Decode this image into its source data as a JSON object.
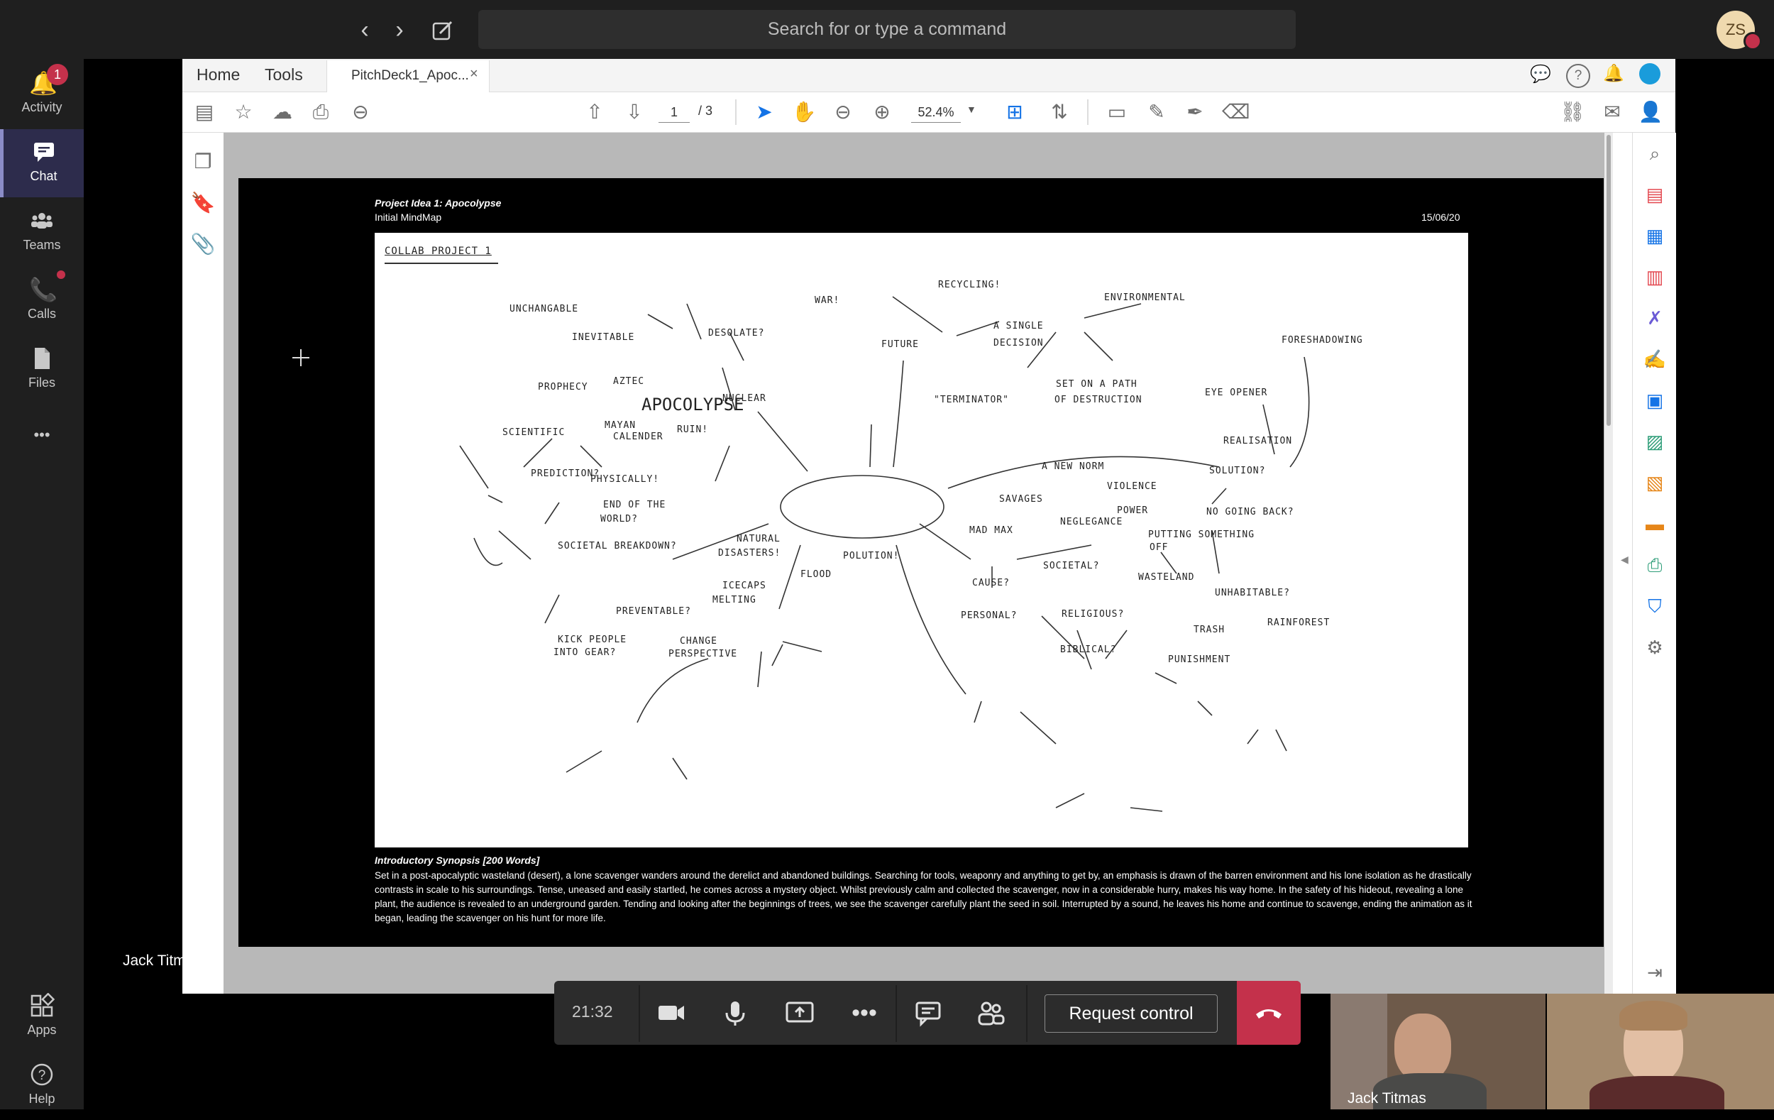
{
  "topbar": {
    "back_glyph": "‹",
    "forward_glyph": "›",
    "search_placeholder": "Search for or type a command",
    "avatar_initials": "ZS"
  },
  "rail": {
    "activity": {
      "label": "Activity",
      "badge": "1"
    },
    "chat": {
      "label": "Chat"
    },
    "teams": {
      "label": "Teams"
    },
    "calls": {
      "label": "Calls"
    },
    "files": {
      "label": "Files"
    },
    "more": {
      "label": "•••"
    },
    "apps": {
      "label": "Apps"
    },
    "help": {
      "label": "Help"
    }
  },
  "pdf": {
    "menu": {
      "home": "Home",
      "tools": "Tools"
    },
    "doc_tab": "PitchDeck1_Apoc...",
    "doc_tab_close": "×",
    "page_current": "1",
    "page_total": "/ 3",
    "zoom": "52.4%"
  },
  "slide": {
    "title": "Project Idea 1: Apocolypse",
    "subtitle": "Initial MindMap",
    "date": "15/06/20",
    "synopsis_title": "Introductory Synopsis [200 Words]",
    "synopsis_text": "Set in a post-apocalyptic wasteland (desert), a lone scavenger wanders around the derelict and abandoned buildings. Searching for tools, weaponry and anything to get by, an emphasis is drawn of the barren environment and his lone isolation as he drastically contrasts in scale to his surroundings. Tense, uneased and easily startled, he comes across a mystery object. Whilst previously calm and collected the scavenger, now in a considerable hurry, makes his way home. In the safety of his hideout, revealing a lone plant, the audience is revealed to an underground garden. Tending and looking after the beginnings of trees, we see the scavenger carefully plant the seed in soil. Interrupted by a sound, he leaves his home and continue to scavenge, ending the animation as it began, leading the scavenger on his hunt for more life."
  },
  "mindmap": {
    "header": "COLLAB PROJECT 1",
    "center": "APOCOLYPSE",
    "nodes": [
      "UNCHANGABLE",
      "INEVITABLE",
      "DESOLATE?",
      "WAR!",
      "RECYCLING!",
      "ENVIRONMENTAL",
      "A SINGLE",
      "DECISION",
      "FUTURE",
      "FORESHADOWING",
      "PROPHECY",
      "AZTEC",
      "NUCLEAR",
      "\"TERMINATOR\"",
      "SET ON A PATH",
      "OF DESTRUCTION",
      "EYE OPENER",
      "SCIENTIFIC",
      "MAYAN",
      "CALENDER",
      "RUIN!",
      "REALISATION",
      "A NEW NORM",
      "PREDICTION?",
      "PHYSICALLY!",
      "SOLUTION?",
      "VIOLENCE",
      "SAVAGES",
      "END OF THE",
      "WORLD?",
      "POWER",
      "NO GOING BACK?",
      "MAD MAX",
      "NEGLEGANCE",
      "NATURAL",
      "DISASTERS!",
      "PUTTING SOMETHING",
      "OFF",
      "SOCIETAL BREAKDOWN?",
      "POLUTION!",
      "SOCIETAL?",
      "FLOOD",
      "CAUSE?",
      "WASTELAND",
      "ICECAPS",
      "MELTING",
      "UNHABITABLE?",
      "PREVENTABLE?",
      "PERSONAL?",
      "RELIGIOUS?",
      "TRASH",
      "RAINFOREST",
      "KICK PEOPLE",
      "INTO GEAR?",
      "CHANGE",
      "PERSPECTIVE",
      "BIBLICAL?",
      "PUNISHMENT"
    ]
  },
  "presenter_label": "Jack Titmas",
  "call": {
    "duration": "21:32",
    "request_control": "Request control"
  },
  "video": {
    "tile1_name": "Jack Titmas"
  }
}
